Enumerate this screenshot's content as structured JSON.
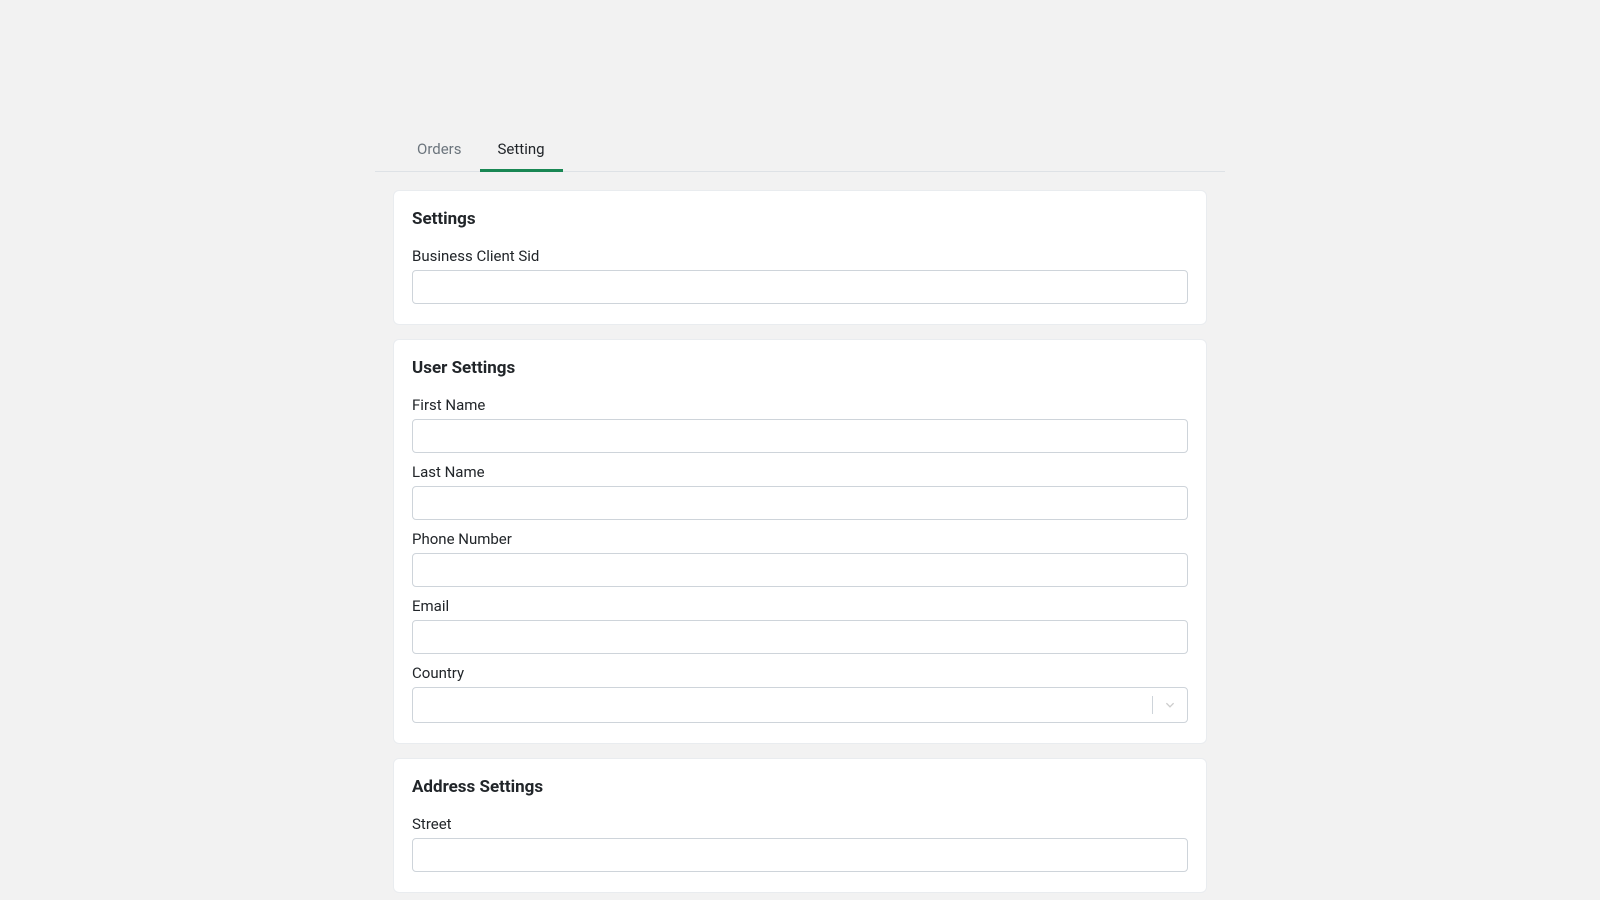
{
  "tabs": {
    "orders": "Orders",
    "setting": "Setting"
  },
  "colors": {
    "accent": "#198754"
  },
  "sections": {
    "settings": {
      "title": "Settings",
      "fields": {
        "business_client_sid": {
          "label": "Business Client Sid",
          "value": ""
        }
      }
    },
    "user_settings": {
      "title": "User Settings",
      "fields": {
        "first_name": {
          "label": "First Name",
          "value": ""
        },
        "last_name": {
          "label": "Last Name",
          "value": ""
        },
        "phone_number": {
          "label": "Phone Number",
          "value": ""
        },
        "email": {
          "label": "Email",
          "value": ""
        },
        "country": {
          "label": "Country",
          "value": ""
        }
      }
    },
    "address_settings": {
      "title": "Address Settings",
      "fields": {
        "street": {
          "label": "Street",
          "value": ""
        }
      }
    }
  }
}
